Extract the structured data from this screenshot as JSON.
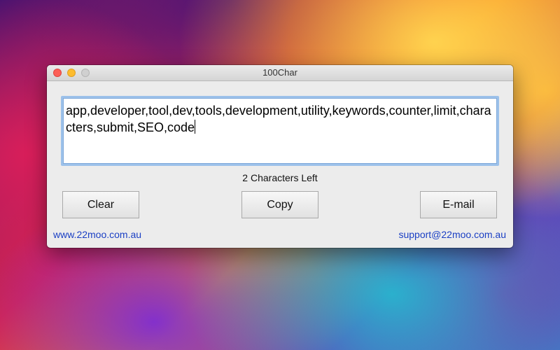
{
  "window": {
    "title": "100Char",
    "controls": {
      "close": "close-icon",
      "minimize": "minimize-icon",
      "maximize": "maximize-icon"
    }
  },
  "editor": {
    "value": "app,developer,tool,dev,tools,development,utility,keywords,counter,limit,characters,submit,SEO,code"
  },
  "status": {
    "text": "2 Characters Left"
  },
  "buttons": {
    "clear": "Clear",
    "copy": "Copy",
    "email": "E-mail"
  },
  "links": {
    "website": "www.22moo.com.au",
    "support": "support@22moo.com.au"
  },
  "colors": {
    "link": "#1a3fc4",
    "focus_ring": "#9cc1ea",
    "close": "#fc5f57",
    "minimize": "#fdbc2e"
  }
}
